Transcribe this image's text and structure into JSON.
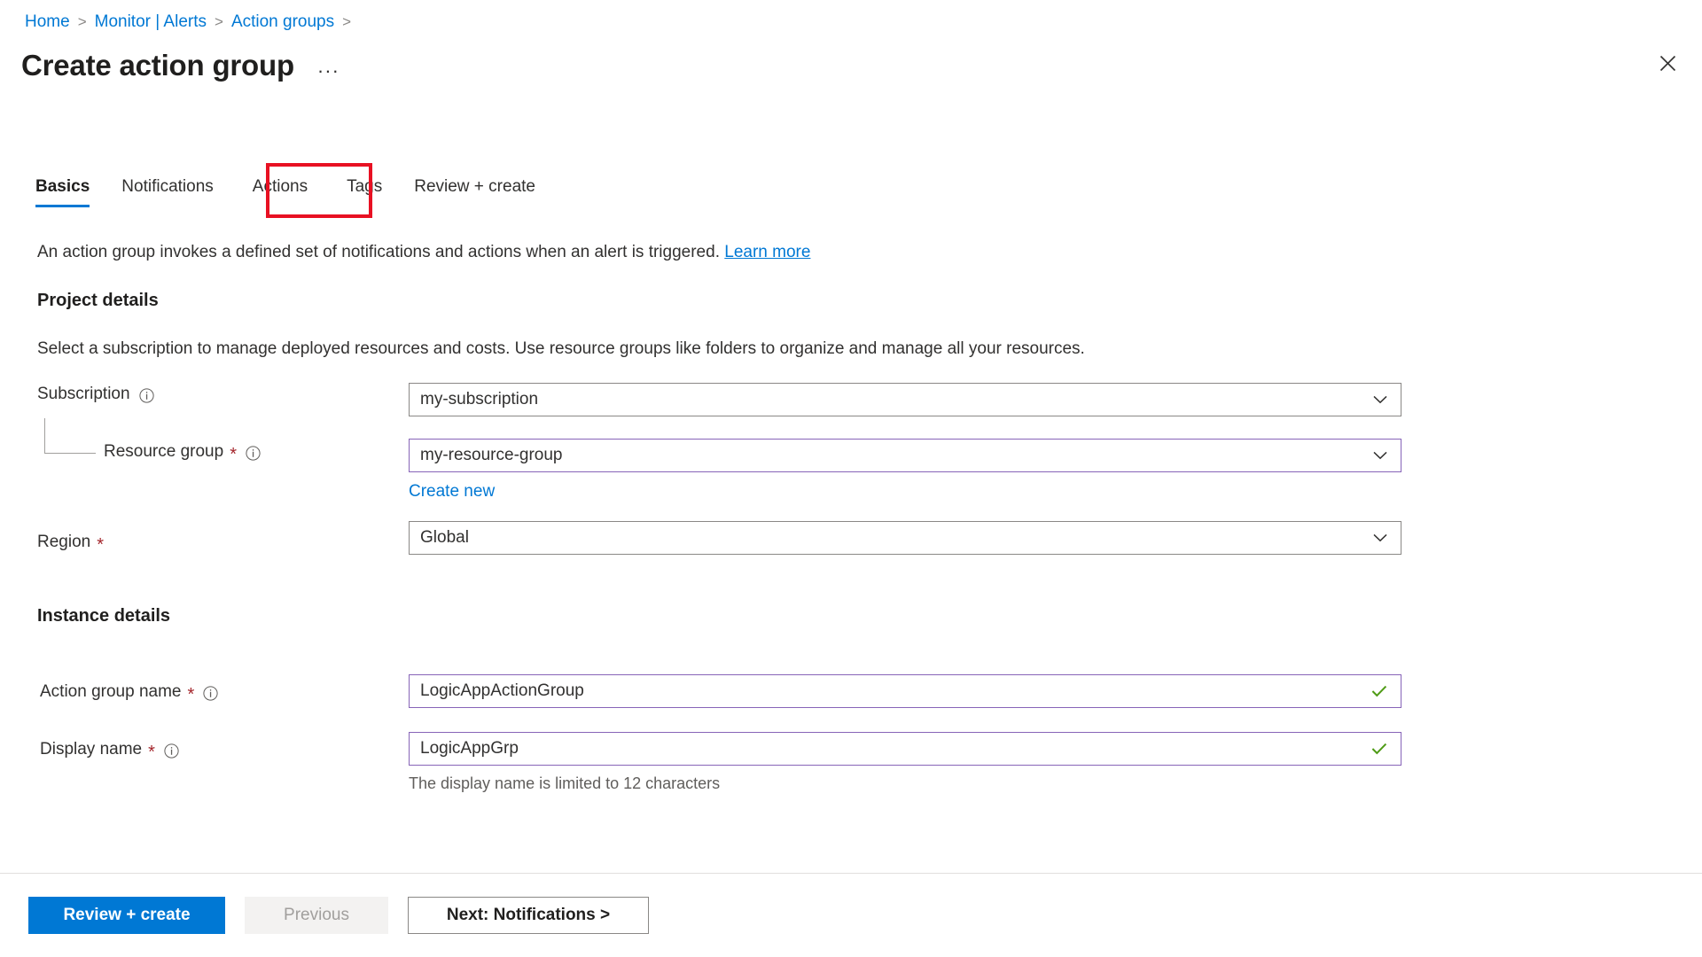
{
  "breadcrumb": {
    "items": [
      {
        "label": "Home"
      },
      {
        "label": "Monitor | Alerts"
      },
      {
        "label": "Action groups"
      }
    ],
    "separator": ">"
  },
  "header": {
    "title": "Create action group",
    "ellipsis": "···",
    "close_icon": "close-icon"
  },
  "tabs": [
    {
      "label": "Basics",
      "active": true
    },
    {
      "label": "Notifications",
      "active": false
    },
    {
      "label": "Actions",
      "active": false,
      "highlighted": true
    },
    {
      "label": "Tags",
      "active": false
    },
    {
      "label": "Review + create",
      "active": false
    }
  ],
  "intro": {
    "text": "An action group invokes a defined set of notifications and actions when an alert is triggered.",
    "link_label": "Learn more"
  },
  "project_details": {
    "heading": "Project details",
    "description": "Select a subscription to manage deployed resources and costs. Use resource groups like folders to organize and manage all your resources.",
    "subscription": {
      "label": "Subscription",
      "value": "my-subscription",
      "required": false,
      "info_icon": "info-icon",
      "chevron_icon": "chevron-down-icon"
    },
    "resource_group": {
      "label": "Resource group",
      "value": "my-resource-group",
      "required": true,
      "required_marker": "*",
      "info_icon": "info-icon",
      "chevron_icon": "chevron-down-icon",
      "create_new_label": "Create new"
    },
    "region": {
      "label": "Region",
      "value": "Global",
      "required": true,
      "required_marker": "*",
      "chevron_icon": "chevron-down-icon"
    }
  },
  "instance_details": {
    "heading": "Instance details",
    "action_group_name": {
      "label": "Action group name",
      "value": "LogicAppActionGroup",
      "required": true,
      "required_marker": "*",
      "info_icon": "info-icon",
      "validation_icon": "checkmark-icon"
    },
    "display_name": {
      "label": "Display name",
      "value": "LogicAppGrp",
      "required": true,
      "required_marker": "*",
      "info_icon": "info-icon",
      "validation_icon": "checkmark-icon",
      "helper_text": "The display name is limited to 12 characters"
    }
  },
  "footer": {
    "review_create_label": "Review + create",
    "previous_label": "Previous",
    "next_label": "Next: Notifications >"
  },
  "colors": {
    "accent_blue": "#0078d4",
    "link_blue": "#0078d4",
    "highlight_red": "#e81123",
    "required_red": "#a4262c",
    "focus_purple": "#8764b8",
    "success_green": "#4f9b16",
    "text_primary": "#323130",
    "border_grey": "#8a8886"
  }
}
